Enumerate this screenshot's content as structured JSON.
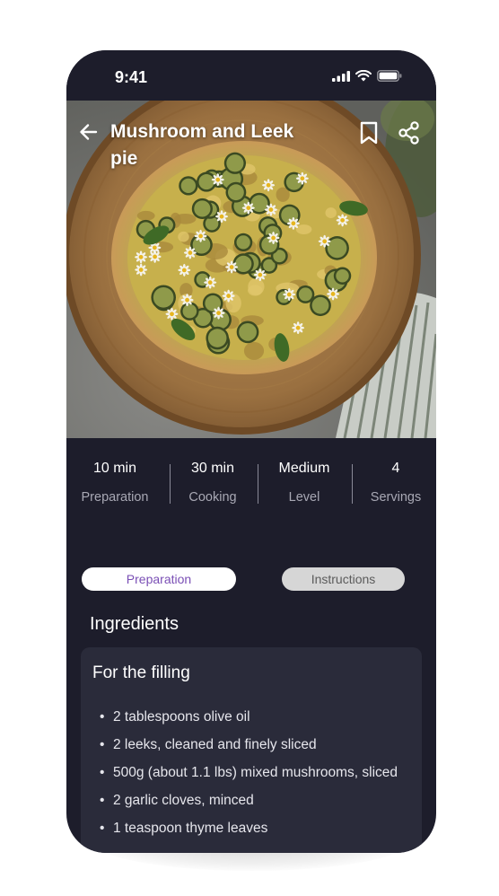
{
  "status_bar": {
    "time": "9:41",
    "icons": [
      "cellular-signal-icon",
      "wifi-icon",
      "battery-icon"
    ]
  },
  "recipe": {
    "title": "Mushroom and Leek pie"
  },
  "header_icons": [
    "arrow-left-icon",
    "bookmark-icon",
    "share-icon"
  ],
  "stats": [
    {
      "value": "10 min",
      "label": "Preparation"
    },
    {
      "value": "30 min",
      "label": "Cooking"
    },
    {
      "value": "Medium",
      "label": "Level"
    },
    {
      "value": "4",
      "label": "Servings"
    }
  ],
  "tabs": [
    {
      "label": "Preparation",
      "active": true
    },
    {
      "label": "Instructions",
      "active": false
    }
  ],
  "ingredients": {
    "heading": "Ingredients",
    "card_title": "For the filling",
    "items": [
      "2 tablespoons olive oil",
      "2 leeks, cleaned and finely sliced",
      "500g (about 1.1 lbs) mixed mushrooms, sliced",
      "2 garlic cloves, minced",
      "1 teaspoon thyme leaves"
    ]
  },
  "colors": {
    "background": "#1d1d2b",
    "card": "#2a2b3a",
    "accent": "#7a4fb5",
    "muted_text": "#a8a8b4"
  }
}
